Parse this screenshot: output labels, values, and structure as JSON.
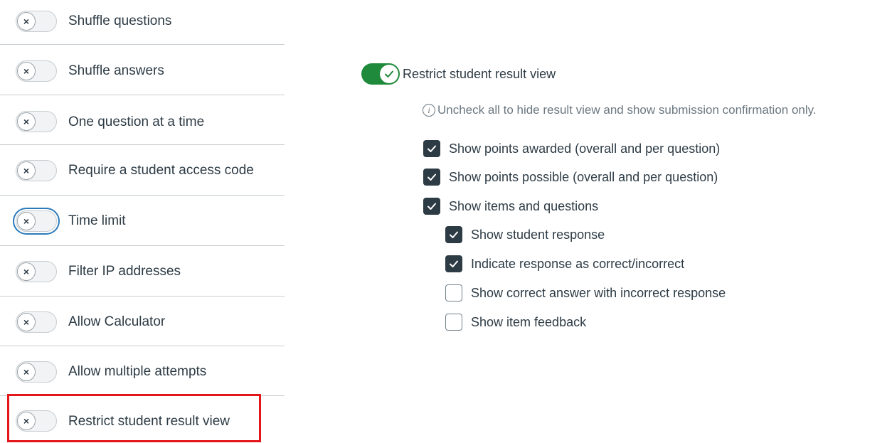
{
  "settings": [
    {
      "label": "Shuffle questions",
      "enabled": false
    },
    {
      "label": "Shuffle answers",
      "enabled": false
    },
    {
      "label": "One question at a time",
      "enabled": false
    },
    {
      "label": "Require a student access code",
      "enabled": false
    },
    {
      "label": "Time limit",
      "enabled": false
    },
    {
      "label": "Filter IP addresses",
      "enabled": false
    },
    {
      "label": "Allow Calculator",
      "enabled": false
    },
    {
      "label": "Allow multiple attempts",
      "enabled": false
    },
    {
      "label": "Restrict student result view",
      "enabled": false
    }
  ],
  "toggle_off_glyph": "×",
  "restrict_panel": {
    "title": "Restrict student result view",
    "enabled": true,
    "info_glyph": "i",
    "info_text": "Uncheck all to hide result view and show submission confirmation only.",
    "options": [
      {
        "label": "Show points awarded (overall and per question)",
        "checked": true
      },
      {
        "label": "Show points possible (overall and per question)",
        "checked": true
      },
      {
        "label": "Show items and questions",
        "checked": true
      },
      {
        "label": "Show student response",
        "checked": true
      },
      {
        "label": "Indicate response as correct/incorrect",
        "checked": true
      },
      {
        "label": "Show correct answer with incorrect response",
        "checked": false
      },
      {
        "label": "Show item feedback",
        "checked": false
      }
    ]
  },
  "colors": {
    "toggle_on": "#1f8a3b",
    "highlight": "#e3161a",
    "focus_ring": "#2b7abc",
    "checkbox_checked": "#2d3b45"
  }
}
